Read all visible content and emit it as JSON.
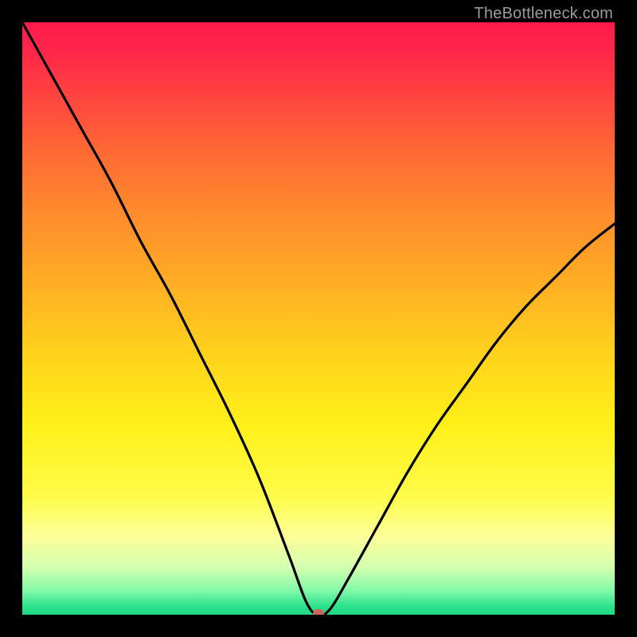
{
  "watermark": "TheBottleneck.com",
  "marker": {
    "color": "#c96a5c"
  },
  "chart_data": {
    "type": "line",
    "title": "",
    "xlabel": "",
    "ylabel": "",
    "xlim": [
      0,
      100
    ],
    "ylim": [
      0,
      100
    ],
    "grid": false,
    "legend": false,
    "x": [
      0,
      5,
      10,
      15,
      20,
      25,
      30,
      35,
      40,
      45,
      48,
      50,
      52,
      55,
      60,
      65,
      70,
      75,
      80,
      85,
      90,
      95,
      100
    ],
    "values": [
      100,
      91,
      82,
      73,
      63,
      54,
      44,
      34,
      23,
      10,
      2,
      0,
      1,
      6,
      15,
      24,
      32,
      39,
      46,
      52,
      57,
      62,
      66
    ],
    "marker_point": {
      "x": 50,
      "y": 0
    }
  }
}
